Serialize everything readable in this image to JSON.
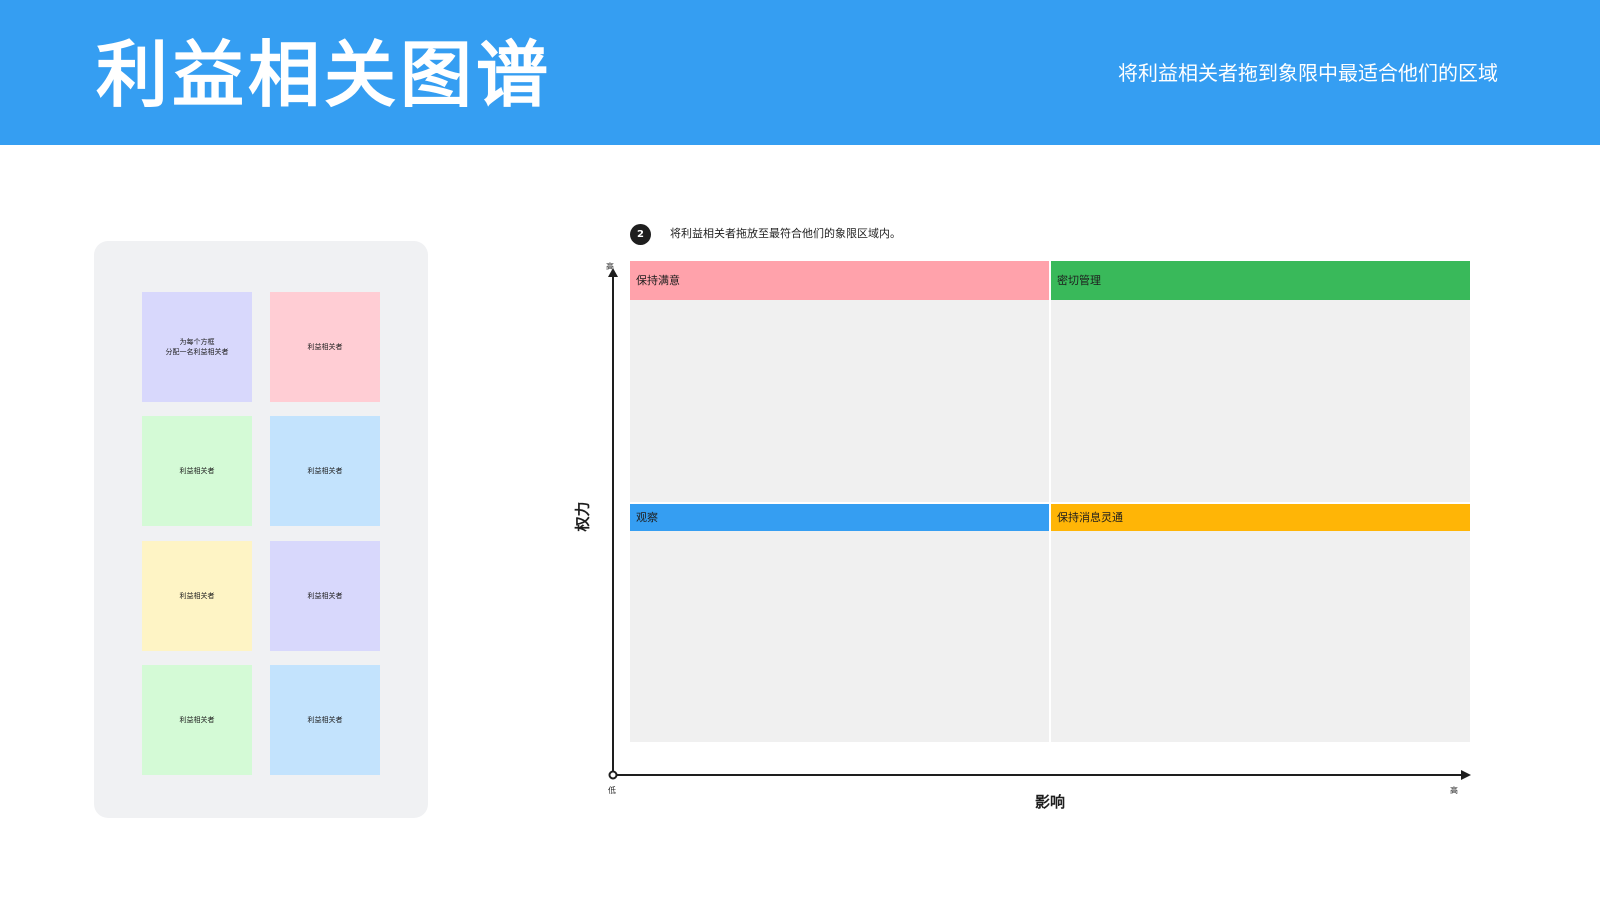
{
  "header": {
    "title": "利益相关图谱",
    "subtitle": "将利益相关者拖到象限中最适合他们的区域",
    "background": "#359ef2"
  },
  "instruction": {
    "step": "2",
    "text": "将利益相关者拖放至最符合他们的象限区域内。"
  },
  "stickies": [
    {
      "label": "为每个方框\n分配一名利益相关者",
      "color": "#d8d8fc"
    },
    {
      "label": "利益相关者",
      "color": "#ffcdd4"
    },
    {
      "label": "利益相关者",
      "color": "#d4fad6"
    },
    {
      "label": "利益相关者",
      "color": "#c3e3fd"
    },
    {
      "label": "利益相关者",
      "color": "#fef4c5"
    },
    {
      "label": "利益相关者",
      "color": "#d8d8fc"
    },
    {
      "label": "利益相关者",
      "color": "#d4fad6"
    },
    {
      "label": "利益相关者",
      "color": "#c3e3fd"
    }
  ],
  "quadrants": [
    {
      "label": "保持满意",
      "color": "#ffa2ab"
    },
    {
      "label": "密切管理",
      "color": "#39b95a"
    },
    {
      "label": "观察",
      "color": "#359ef2"
    },
    {
      "label": "保持消息灵通",
      "color": "#ffb506"
    }
  ],
  "axes": {
    "y_title": "权力",
    "x_title": "影响",
    "y_high": "高",
    "x_low": "低",
    "x_high": "高"
  }
}
